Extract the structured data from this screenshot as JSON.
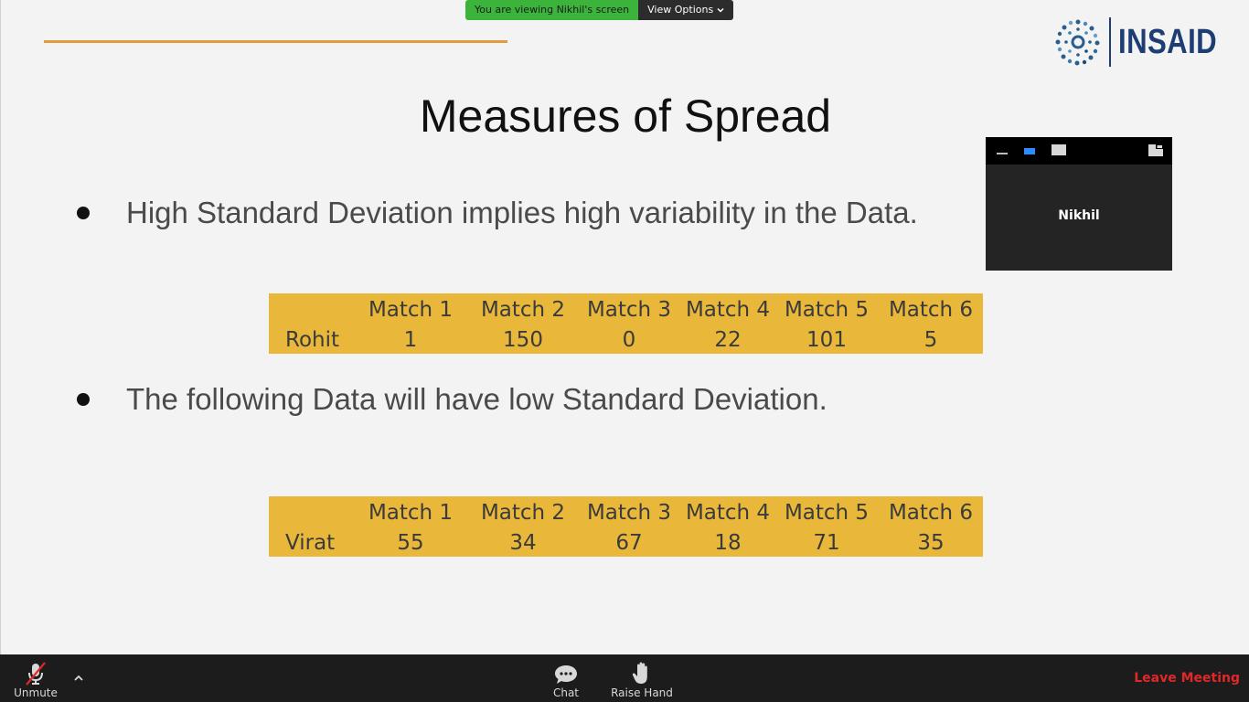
{
  "share_banner": {
    "status": "You are viewing Nikhil's screen",
    "options_label": "View Options"
  },
  "logo": {
    "text": "INSAID"
  },
  "slide": {
    "title": "Measures of Spread",
    "bullets": [
      "High Standard Deviation implies high variability in the Data.",
      "The following Data will have low Standard Deviation."
    ],
    "tables": [
      {
        "row_label": "Rohit",
        "headers": [
          "Match 1",
          "Match 2",
          "Match 3",
          "Match 4",
          "Match 5",
          "Match 6"
        ],
        "values": [
          "1",
          "150",
          "0",
          "22",
          "101",
          "5"
        ]
      },
      {
        "row_label": "Virat",
        "headers": [
          "Match 1",
          "Match 2",
          "Match 3",
          "Match 4",
          "Match 5",
          "Match 6"
        ],
        "values": [
          "55",
          "34",
          "67",
          "18",
          "71",
          "35"
        ]
      }
    ]
  },
  "video": {
    "participant_name": "Nikhil"
  },
  "toolbar": {
    "unmute_label": "Unmute",
    "chat_label": "Chat",
    "raise_hand_label": "Raise Hand",
    "leave_label": "Leave Meeting"
  },
  "colors": {
    "accent_line": "#e29a3e",
    "table_fill": "#e9b83a",
    "banner_green": "#3cb43c",
    "leave_red": "#e02828",
    "logo_blue": "#1d3d73"
  }
}
